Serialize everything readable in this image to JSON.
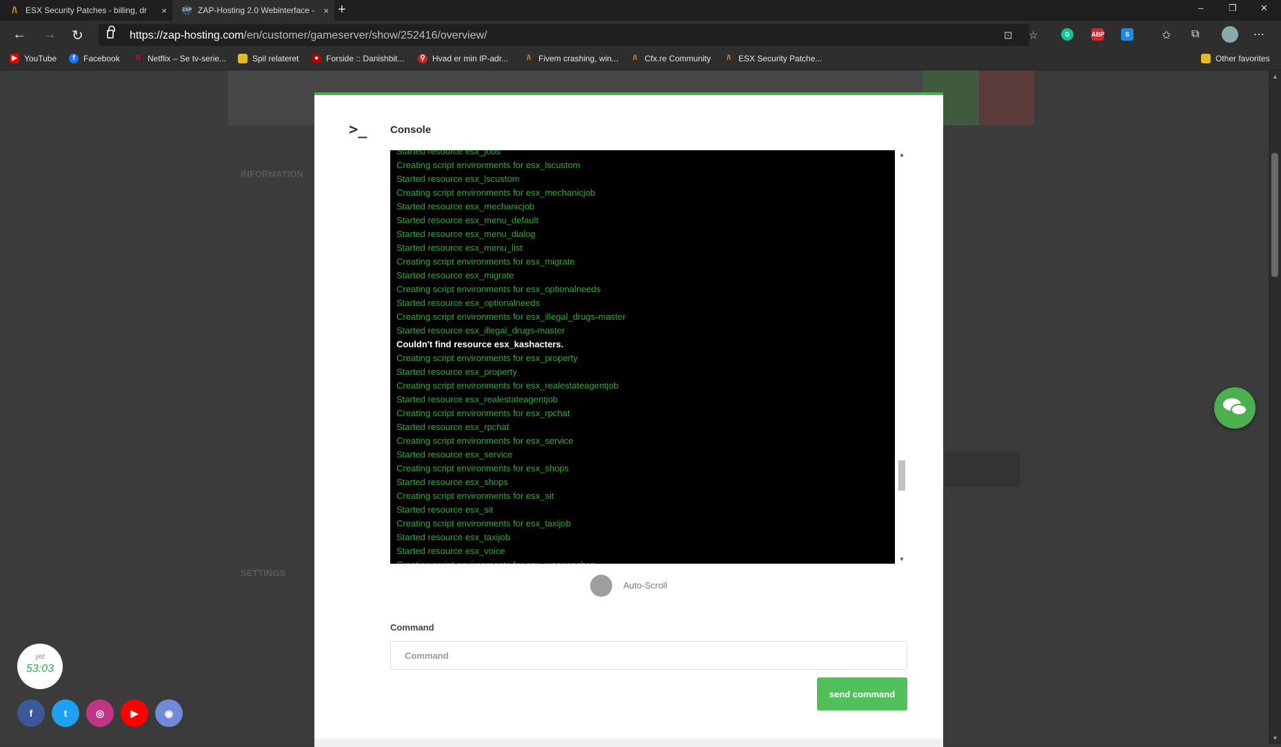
{
  "browser": {
    "tabs": [
      {
        "title": "ESX Security Patches - billing, dr",
        "close": "×"
      },
      {
        "title": "ZAP-Hosting 2.0 Webinterface - ",
        "close": "×"
      }
    ],
    "new_tab": "+",
    "window_controls": [
      "–",
      "❐",
      "✕"
    ],
    "url_host": "https://zap-hosting.com",
    "url_path": "/en/customer/gameserver/show/252416/overview/",
    "bookmarks": [
      "YouTube",
      "Facebook",
      "Netflix – Se tv-serie...",
      "Spil relateret",
      "Forside :: Danishbit...",
      "Hvad er min IP-adr...",
      "Fivem crashing, win...",
      "Cfx.re Community",
      "ESX Security Patche..."
    ],
    "other_favorites": "Other favorites",
    "extensions": [
      "G",
      "ABP",
      "S"
    ]
  },
  "background": {
    "sidebar_information": "INFORMATION",
    "sidebar_settings": "SETTINGS"
  },
  "modal": {
    "title": "Console",
    "console_lines": [
      {
        "text": "Started resource esx_jobs",
        "type": "info"
      },
      {
        "text": "Creating script environments for esx_lscustom",
        "type": "info"
      },
      {
        "text": "Started resource esx_lscustom",
        "type": "info"
      },
      {
        "text": "Creating script environments for esx_mechanicjob",
        "type": "info"
      },
      {
        "text": "Started resource esx_mechanicjob",
        "type": "info"
      },
      {
        "text": "Started resource esx_menu_default",
        "type": "info"
      },
      {
        "text": "Started resource esx_menu_dialog",
        "type": "info"
      },
      {
        "text": "Started resource esx_menu_list",
        "type": "info"
      },
      {
        "text": "Creating script environments for esx_migrate",
        "type": "info"
      },
      {
        "text": "Started resource esx_migrate",
        "type": "info"
      },
      {
        "text": "Creating script environments for esx_optionalneeds",
        "type": "info"
      },
      {
        "text": "Started resource esx_optionalneeds",
        "type": "info"
      },
      {
        "text": "Creating script environments for esx_illegal_drugs-master",
        "type": "info"
      },
      {
        "text": "Started resource esx_illegal_drugs-master",
        "type": "info"
      },
      {
        "text": "Couldn't find resource esx_kashacters.",
        "type": "err"
      },
      {
        "text": "Creating script environments for esx_property",
        "type": "info"
      },
      {
        "text": "Started resource esx_property",
        "type": "info"
      },
      {
        "text": "Creating script environments for esx_realestateagentjob",
        "type": "info"
      },
      {
        "text": "Started resource esx_realestateagentjob",
        "type": "info"
      },
      {
        "text": "Creating script environments for esx_rpchat",
        "type": "info"
      },
      {
        "text": "Started resource esx_rpchat",
        "type": "info"
      },
      {
        "text": "Creating script environments for esx_service",
        "type": "info"
      },
      {
        "text": "Started resource esx_service",
        "type": "info"
      },
      {
        "text": "Creating script environments for esx_shops",
        "type": "info"
      },
      {
        "text": "Started resource esx_shops",
        "type": "info"
      },
      {
        "text": "Creating script environments for esx_sit",
        "type": "info"
      },
      {
        "text": "Started resource esx_sit",
        "type": "info"
      },
      {
        "text": "Creating script environments for esx_taxijob",
        "type": "info"
      },
      {
        "text": "Started resource esx_taxijob",
        "type": "info"
      },
      {
        "text": "Started resource esx_voice",
        "type": "info"
      },
      {
        "text": "Creating script environments for esx_weaponshop",
        "type": "info"
      }
    ],
    "autoscroll_label": "Auto-Scroll",
    "autoscroll_enabled": false,
    "command_label": "Command",
    "command_placeholder": "Command",
    "command_value": "",
    "send_label": "send command"
  },
  "timer": {
    "label": "yet",
    "value": "53:03"
  },
  "social": [
    {
      "name": "facebook",
      "glyph": "f",
      "color": "#3b5998"
    },
    {
      "name": "twitter",
      "glyph": "t",
      "color": "#1da1f2"
    },
    {
      "name": "instagram",
      "glyph": "◎",
      "color": "#c13584"
    },
    {
      "name": "youtube",
      "glyph": "▶",
      "color": "#ff0000"
    },
    {
      "name": "discord",
      "glyph": "◉",
      "color": "#7289da"
    }
  ],
  "colors": {
    "accent": "#4caf50",
    "console_text": "#20b424",
    "console_error": "#ffffff"
  }
}
